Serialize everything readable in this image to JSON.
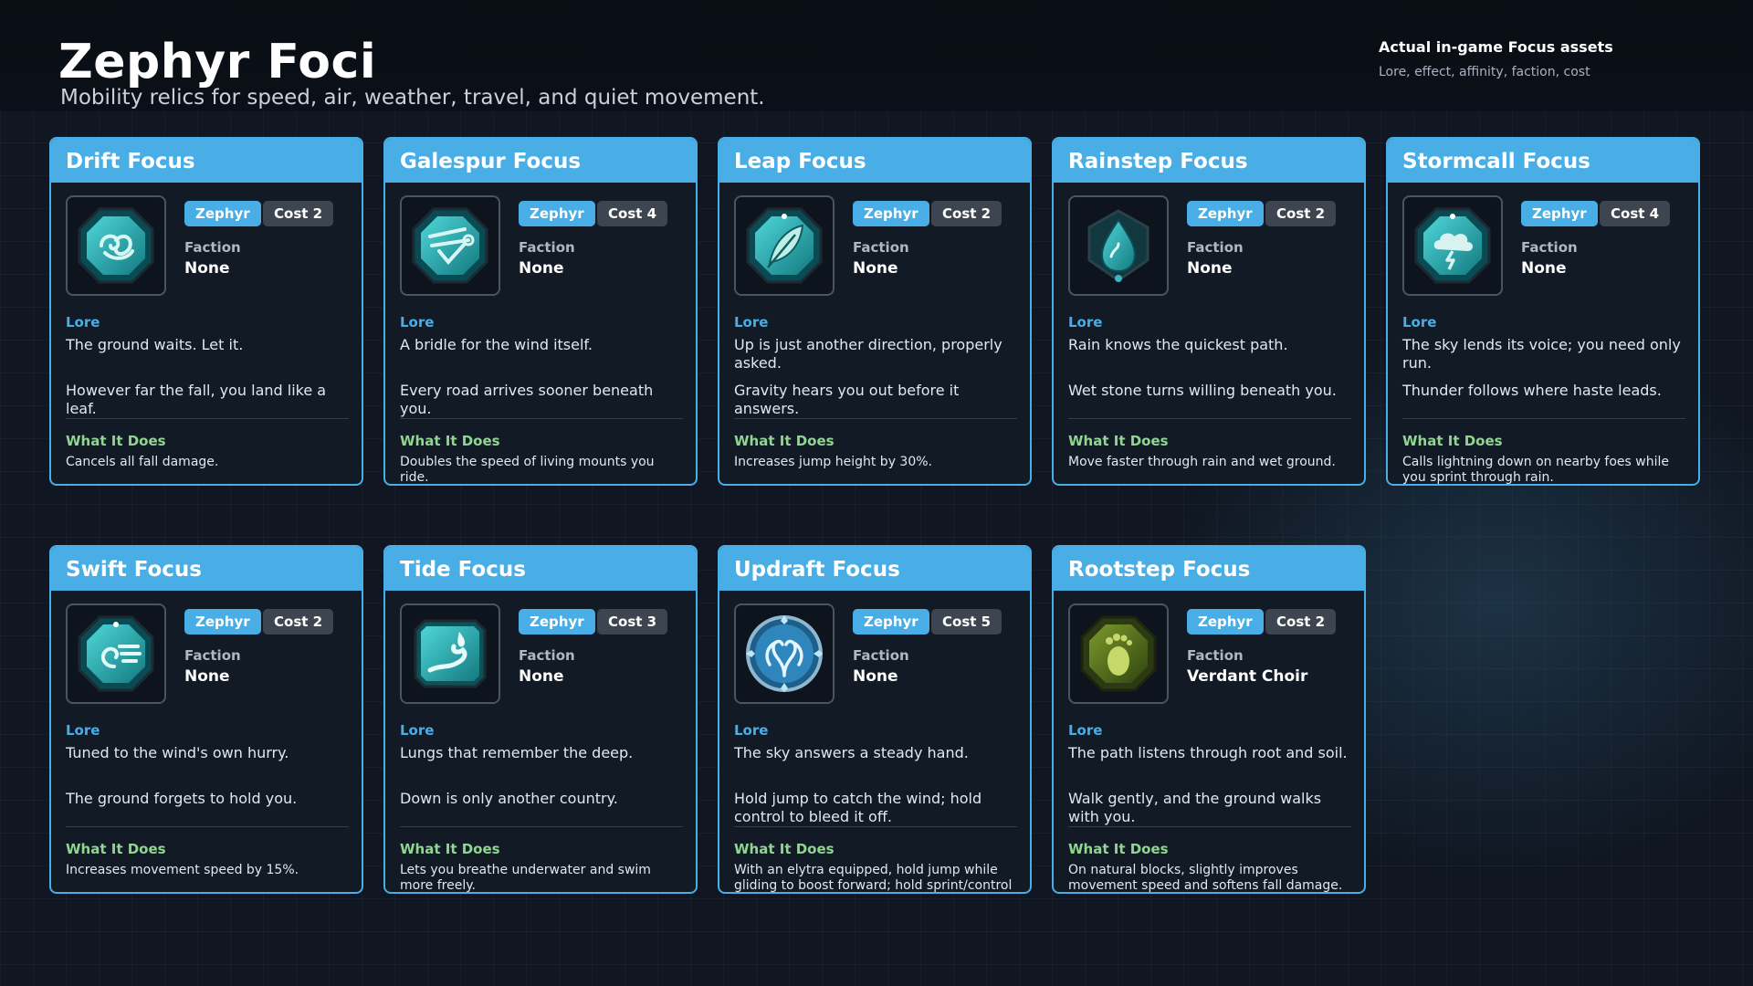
{
  "header": {
    "title": "Zephyr Foci",
    "subtitle": "Mobility relics for speed, air, weather, travel, and quiet movement.",
    "note_title": "Actual in-game Focus assets",
    "note_subtitle": "Lore, effect, affinity, faction, cost"
  },
  "labels": {
    "faction": "Faction",
    "lore": "Lore",
    "what": "What It Does"
  },
  "colors": {
    "accent": "#4aaee6",
    "what_green": "#8fd68f",
    "cost_pill": "#3d4551"
  },
  "cards": [
    {
      "title": "Drift Focus",
      "affinity": "Zephyr",
      "cost": "Cost 2",
      "faction": "None",
      "icon": "swirl-gem-icon",
      "lore1": "The ground waits. Let it.",
      "lore2": "However far the fall, you land like a leaf.",
      "what": "Cancels all fall damage."
    },
    {
      "title": "Galespur Focus",
      "affinity": "Zephyr",
      "cost": "Cost 4",
      "faction": "None",
      "icon": "spur-gem-icon",
      "lore1": "A bridle for the wind itself.",
      "lore2": "Every road arrives sooner beneath you.",
      "what": "Doubles the speed of living mounts you ride."
    },
    {
      "title": "Leap Focus",
      "affinity": "Zephyr",
      "cost": "Cost 2",
      "faction": "None",
      "icon": "feather-gem-icon",
      "lore1": "Up is just another direction, properly asked.",
      "lore2": "Gravity hears you out before it answers.",
      "what": "Increases jump height by 30%."
    },
    {
      "title": "Rainstep Focus",
      "affinity": "Zephyr",
      "cost": "Cost 2",
      "faction": "None",
      "icon": "raindrop-gem-icon",
      "lore1": "Rain knows the quickest path.",
      "lore2": "Wet stone turns willing beneath you.",
      "what": "Move faster through rain and wet ground."
    },
    {
      "title": "Stormcall Focus",
      "affinity": "Zephyr",
      "cost": "Cost 4",
      "faction": "None",
      "icon": "storm-cloud-gem-icon",
      "lore1": "The sky lends its voice; you need only run.",
      "lore2": "Thunder follows where haste leads.",
      "what": "Calls lightning down on nearby foes while you sprint through rain."
    },
    {
      "title": "Swift Focus",
      "affinity": "Zephyr",
      "cost": "Cost 2",
      "faction": "None",
      "icon": "wind-gem-icon",
      "lore1": "Tuned to the wind's own hurry.",
      "lore2": "The ground forgets to hold you.",
      "what": "Increases movement speed by 15%."
    },
    {
      "title": "Tide Focus",
      "affinity": "Zephyr",
      "cost": "Cost 3",
      "faction": "None",
      "icon": "wave-gem-icon",
      "lore1": "Lungs that remember the deep.",
      "lore2": "Down is only another country.",
      "what": "Lets you breathe underwater and swim more freely."
    },
    {
      "title": "Updraft Focus",
      "affinity": "Zephyr",
      "cost": "Cost 5",
      "faction": "None",
      "icon": "updraft-medallion-icon",
      "lore1": "The sky answers a steady hand.",
      "lore2": "Hold jump to catch the wind; hold control to bleed it off.",
      "what": "With an elytra equipped, hold jump while gliding to boost forward; hold sprint/control to brake hard."
    },
    {
      "title": "Rootstep Focus",
      "affinity": "Zephyr",
      "cost": "Cost 2",
      "faction": "Verdant Choir",
      "icon": "footprint-gem-icon",
      "lore1": "The path listens through root and soil.",
      "lore2": "Walk gently, and the ground walks with you.",
      "what": "On natural blocks, slightly improves movement speed and softens fall damage."
    }
  ]
}
